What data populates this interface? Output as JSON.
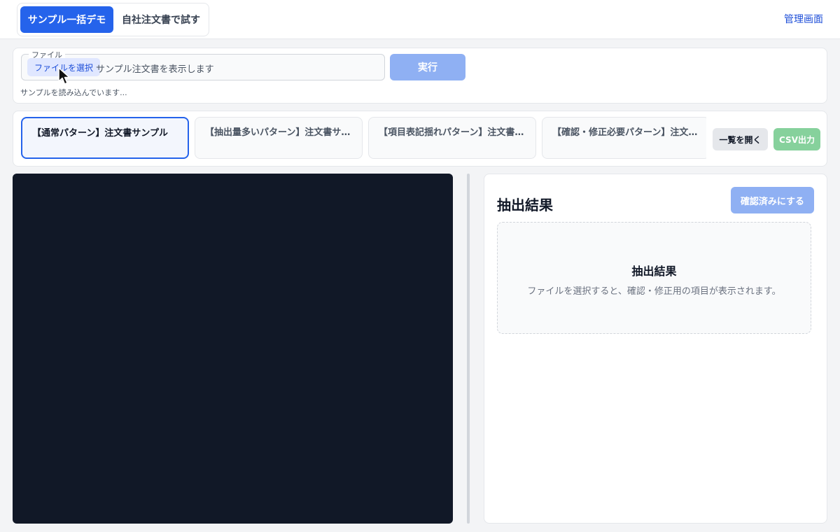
{
  "header": {
    "mode_active_label": "サンプル一括デモ",
    "mode_other_label": "自社注文書で試す",
    "admin_link": "管理画面"
  },
  "file": {
    "legend": "ファイル",
    "choose_label": "ファイルを選択",
    "file_name": "サンプル注文書を表示します",
    "run_label": "実行",
    "status": "サンプルを読み込んでいます..."
  },
  "samples": {
    "tabs": [
      {
        "label": "【通常パターン】注文書サンプル",
        "active": true
      },
      {
        "label": "【抽出量多いパターン】注文書サンプル",
        "active": false
      },
      {
        "label": "【項目表記揺れパターン】注文書サンプル",
        "active": false
      },
      {
        "label": "【確認・修正必要パターン】注文書サンプル",
        "active": false
      }
    ],
    "list_button": "一覧を開く",
    "csv_button": "CSV出力"
  },
  "results": {
    "title": "抽出結果",
    "confirm_button": "確認済みにする",
    "empty_title": "抽出結果",
    "empty_desc": "ファイルを選択すると、確認・修正用の項目が表示されます。"
  },
  "colors": {
    "primary": "#2563eb",
    "primary_disabled": "#8fb0f3",
    "success_disabled": "#86d19c",
    "preview_bg": "#111827"
  }
}
